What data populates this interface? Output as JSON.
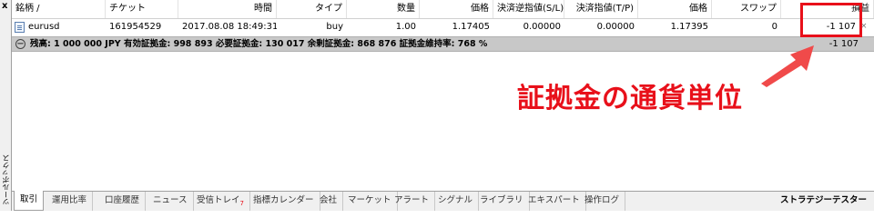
{
  "sidebar": {
    "close_label": "x",
    "title": "ツールボックス"
  },
  "columns": [
    "銘柄 /",
    "チケット",
    "時間",
    "タイプ",
    "数量",
    "価格",
    "決済逆指値(S/L)",
    "決済指値(T/P)",
    "価格",
    "スワップ",
    "損益"
  ],
  "rows": [
    {
      "symbol": "eurusd",
      "ticket": "161954529",
      "time": "2017.08.08 18:49:31",
      "type": "buy",
      "volume": "1.00",
      "open_price": "1.17405",
      "sl": "0.00000",
      "tp": "0.00000",
      "price": "1.17395",
      "swap": "0",
      "profit": "-1 107"
    }
  ],
  "summary": {
    "text": "残高: 1 000 000 JPY  有効証拠金: 998 893  必要証拠金: 130 017  余剰証拠金: 868 876  証拠金維持率: 768 %",
    "total": "-1 107"
  },
  "row_close": "×",
  "annotation": {
    "text": "証拠金の通貨単位",
    "color": "#e8101a"
  },
  "tabs": [
    "取引",
    "運用比率",
    "口座履歴",
    "ニュース",
    "受信トレイ",
    "指標カレンダー",
    "会社",
    "マーケット",
    "アラート",
    "シグナル",
    "ライブラリ",
    "エキスパート",
    "操作ログ"
  ],
  "inbox_badge": "7",
  "tab_right": "ストラテジーテスター",
  "active_tab": "取引"
}
